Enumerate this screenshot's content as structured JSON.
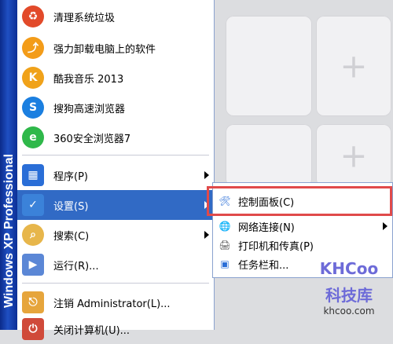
{
  "banner": {
    "text": "Windows XP Professional"
  },
  "menu": {
    "pinned_items": [
      {
        "label": "清理系统垃圾",
        "icon": "cleanup-icon",
        "color": "#e24a2a"
      },
      {
        "label": "强力卸载电脑上的软件",
        "icon": "uninstall-icon",
        "color": "#f39c19"
      },
      {
        "label": "酷我音乐 2013",
        "icon": "kuwo-music-icon",
        "color": "#f0a21a"
      },
      {
        "label": "搜狗高速浏览器",
        "icon": "sogou-browser-icon",
        "color": "#1b7fe0"
      },
      {
        "label": "360安全浏览器7",
        "icon": "360-browser-icon",
        "color": "#2fb84a"
      }
    ],
    "system_items": [
      {
        "label": "程序(P)",
        "icon": "programs-icon"
      },
      {
        "label": "设置(S)",
        "icon": "settings-icon"
      },
      {
        "label": "搜索(C)",
        "icon": "search-icon"
      },
      {
        "label": "运行(R)...",
        "icon": "run-icon"
      },
      {
        "label": "注销 Administrator(L)...",
        "icon": "logoff-icon"
      },
      {
        "label": "关闭计算机(U)...",
        "icon": "shutdown-icon"
      }
    ]
  },
  "submenu": {
    "items": [
      {
        "label": "控制面板(C)",
        "icon": "control-panel-icon"
      },
      {
        "label": "网络连接(N)",
        "icon": "network-icon"
      },
      {
        "label": "打印机和传真(P)",
        "icon": "printer-icon"
      },
      {
        "label": "任务栏和..."
      }
    ]
  },
  "watermark": {
    "logo": "KHCoo",
    "name": "科技库",
    "url": "khcoo.com"
  }
}
